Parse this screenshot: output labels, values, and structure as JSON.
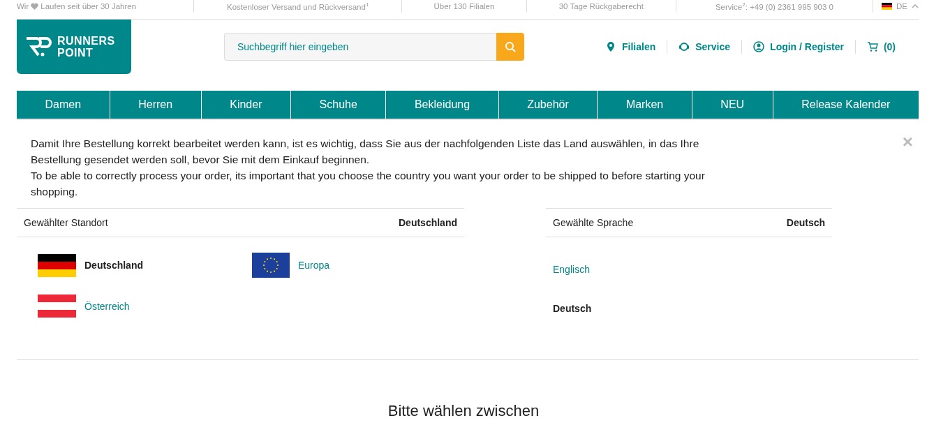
{
  "top_bar": {
    "slogan": {
      "before": "Wir",
      "after": "Laufen seit über 30 Jahren"
    },
    "items": [
      "Kostenloser Versand und Rückversand$^{1}$",
      "Über 130 Filialen",
      "30 Tage Rückgaberecht",
      "Service$^{2}$: +49 (0) 2361 995 903 0"
    ],
    "language": {
      "code": "DE",
      "expanded": true
    }
  },
  "logo": {
    "line_1": "RUNNERS",
    "line_2": "POINT"
  },
  "search": {
    "placeholder": "Suchbegriff hier eingeben"
  },
  "header_links": [
    {
      "kind": "pin",
      "label": "Filialen"
    },
    {
      "kind": "headset",
      "label": "Service"
    },
    {
      "kind": "user",
      "label": "Login / Register"
    },
    {
      "kind": "cart",
      "label": "(0)"
    }
  ],
  "nav": [
    "Damen",
    "Herren",
    "Kinder",
    "Schuhe",
    "Bekleidung",
    "Zubehör",
    "Marken",
    "NEU",
    "Release Kalender"
  ],
  "dialog": {
    "close": "×",
    "intro": [
      "Damit Ihre Bestellung korrekt bearbeitet werden kann, ist es wichtig, dass Sie aus der nachfolgenden Liste das Land auswählen, in das Ihre Bestellung gesendet werden soll, bevor Sie mit dem Einkauf beginnen.",
      "To be able to correctly process your order, its important that you choose the country you want your order to be shipped to before starting your shopping."
    ],
    "location": {
      "label": "Gewählter Standort",
      "value": "Deutschland"
    },
    "countries": [
      {
        "kind": "de",
        "name": "Deutschland",
        "selected": true
      },
      {
        "kind": "eu",
        "name": "Europa",
        "selected": false
      },
      {
        "kind": "at",
        "name": "Österreich",
        "selected": false
      }
    ],
    "language": {
      "label": "Gewählte Sprache",
      "value": "Deutsch"
    },
    "languages": [
      {
        "name": "Englisch",
        "selected": false
      },
      {
        "name": "Deutsch",
        "selected": true
      }
    ]
  },
  "heading": "Bitte wählen zwischen"
}
